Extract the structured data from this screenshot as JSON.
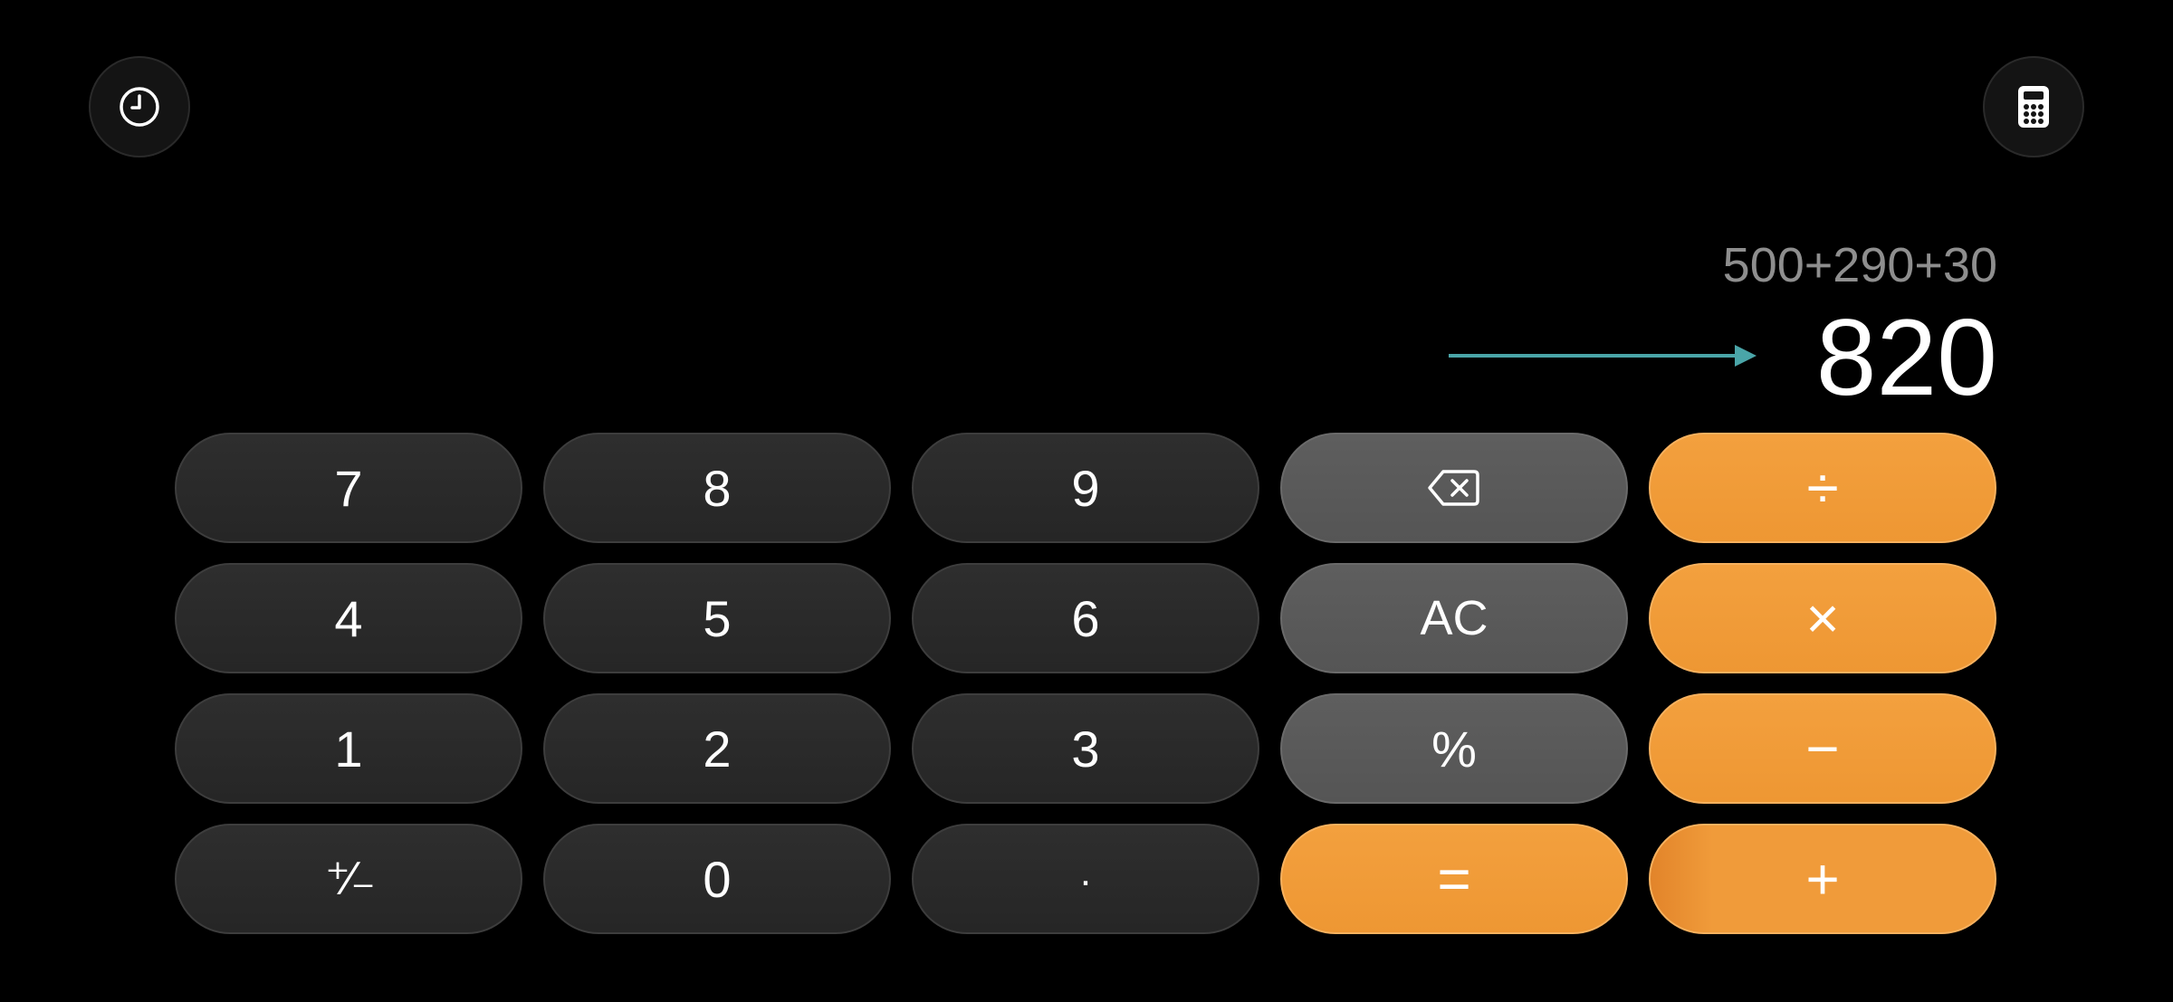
{
  "display": {
    "expression": "500+290+30",
    "result": "820"
  },
  "toolbar": {
    "history_icon": "clock-icon",
    "mode_icon": "calculator-icon"
  },
  "keys": {
    "seven": "7",
    "eight": "8",
    "nine": "9",
    "backspace_icon": "backspace-icon",
    "divide": "÷",
    "four": "4",
    "five": "5",
    "six": "6",
    "clear": "AC",
    "multiply": "×",
    "one": "1",
    "two": "2",
    "three": "3",
    "percent": "%",
    "minus": "−",
    "sign": "⁺∕₋",
    "zero": "0",
    "dot": ".",
    "equals": "=",
    "plus": "+"
  },
  "colors": {
    "background": "#000000",
    "number_key": "#2a2a2a",
    "function_key": "#5a5a5a",
    "operator_key": "#f09b3a",
    "annotation_arrow": "#4aa5a8",
    "expression_text": "#8e8e8e",
    "result_text": "#ffffff"
  }
}
